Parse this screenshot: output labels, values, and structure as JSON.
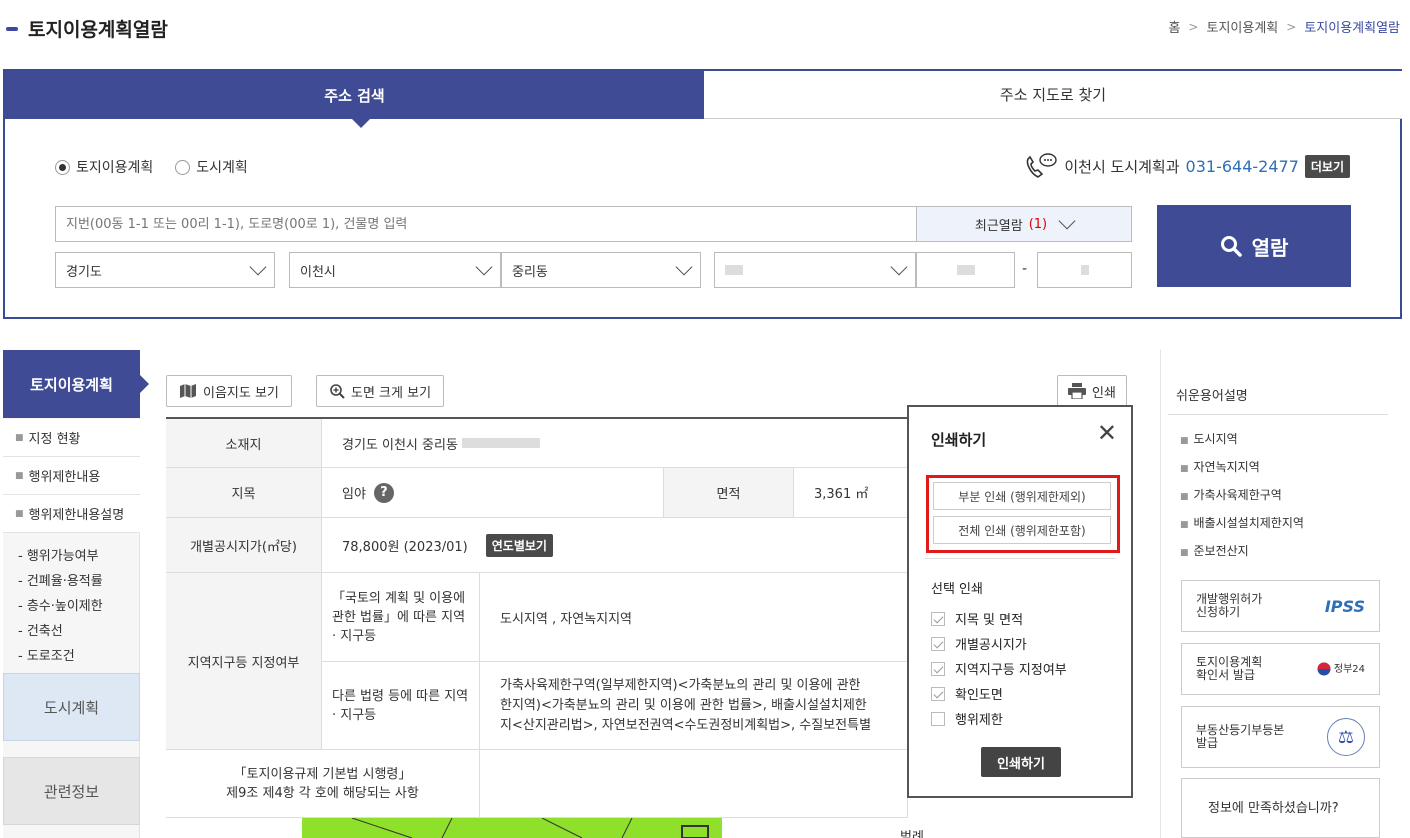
{
  "header": {
    "title": "토지이용계획열람",
    "breadcrumb": [
      "홈",
      "토지이용계획",
      "토지이용계획열람"
    ]
  },
  "search": {
    "tabs": [
      "주소 검색",
      "주소 지도로 찾기"
    ],
    "radios": [
      {
        "label": "토지이용계획",
        "checked": true
      },
      {
        "label": "도시계획",
        "checked": false
      }
    ],
    "contact_label": "이천시 도시계획과",
    "contact_phone": "031-644-2477",
    "contact_more": "더보기",
    "address_placeholder": "지번(00동 1-1 또는 00리 1-1), 도로명(00로 1), 건물명 입력",
    "recent_label": "최근열람",
    "recent_count": "(1)",
    "search_button": "열람",
    "selects": [
      "경기도",
      "이천시",
      "중리동"
    ],
    "dash": "-"
  },
  "left_menu": {
    "active": "토지이용계획",
    "items": [
      "지정 현황",
      "행위제한내용",
      "행위제한내용설명"
    ],
    "sub_items": [
      "- 행위가능여부",
      "- 건폐율·용적률",
      "- 층수·높이제한",
      "- 건축선",
      "- 도로조건"
    ],
    "blocks": [
      "도시계획",
      "관련정보"
    ]
  },
  "toolbar": {
    "map_button": "이음지도 보기",
    "zoom_button": "도면 크게 보기",
    "print_button": "인쇄"
  },
  "table": {
    "location_label": "소재지",
    "location_value": "경기도 이천시 중리동",
    "land_label": "지목",
    "land_value": "임야",
    "area_label": "면적",
    "area_value": "3,361 ㎡",
    "price_label": "개별공시지가(㎡당)",
    "price_value": "78,800원 (2023/01)",
    "price_tag": "연도별보기",
    "zone_label": "지역지구등 지정여부",
    "zone_sub1": "「국토의 계획 및 이용에 관한 법률」에 따른 지역 · 지구등",
    "zone_val1": "도시지역 , 자연녹지지역",
    "zone_sub2": "다른 법령 등에 따른 지역 · 지구등",
    "zone_val2_l1": "가축사육제한구역(일부제한지역)<가축분뇨의 관리 및 이용에 관한",
    "zone_val2_l2": "한지역)<가축분뇨의 관리 및 이용에 관한 법률>, 배출시설설치제한",
    "zone_val2_l3": "지<산지관리법>, 자연보전권역<수도권정비계획법>, 수질보전특별",
    "reg_label_l1": "「토지이용규제 기본법 시행령」",
    "reg_label_l2": "제9조 제4항 각 호에 해당되는 사항",
    "legend_label": "범례"
  },
  "print_popup": {
    "title": "인쇄하기",
    "close": "✕",
    "partial": "부분 인쇄 (행위제한제외)",
    "full": "전체 인쇄 (행위제한포함)",
    "select_label": "선택 인쇄",
    "options": [
      {
        "label": "지목 및 면적",
        "checked": true
      },
      {
        "label": "개별공시지가",
        "checked": true
      },
      {
        "label": "지역지구등 지정여부",
        "checked": true
      },
      {
        "label": "확인도면",
        "checked": true
      },
      {
        "label": "행위제한",
        "checked": false
      }
    ],
    "submit": "인쇄하기"
  },
  "right_panel": {
    "title": "쉬운용어설명",
    "items": [
      "도시지역",
      "자연녹지지역",
      "가축사육제한구역",
      "배출시설설치제한지역",
      "준보전산지"
    ],
    "cards": [
      {
        "l1": "개발행위허가",
        "l2": "신청하기",
        "logo": "IPSS"
      },
      {
        "l1": "토지이용계획",
        "l2": "확인서 발급",
        "logo": "정부24"
      },
      {
        "l1": "부동산등기부등본",
        "l2": "발급",
        "logo": "⚖"
      }
    ],
    "survey_question": "정보에 만족하셨습니까?"
  },
  "colors": {
    "primary": "#3f4c95",
    "accent_red": "#e01a1a",
    "phone": "#2f6fb6"
  }
}
